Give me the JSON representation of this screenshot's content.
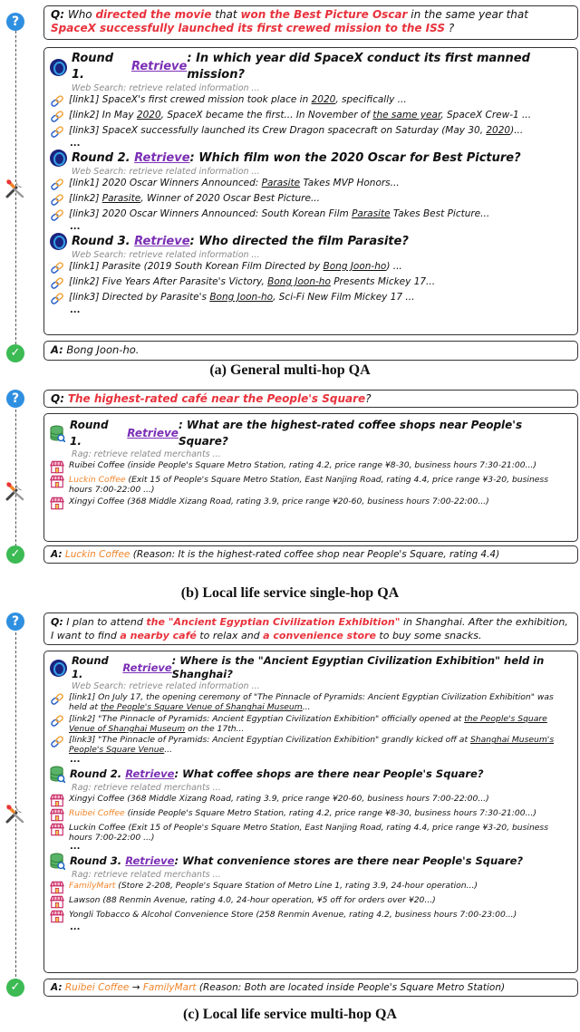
{
  "panels": {
    "a": {
      "caption": "(a) General multi-hop QA",
      "question": {
        "label": "Q:",
        "p1": "Who",
        "h1": "directed the movie",
        "p2": "that",
        "h2": "won the Best Picture Oscar",
        "p3": "in the same year that",
        "h3": "SpaceX successfully launched its first crewed mission to the ISS",
        "p4": "?"
      },
      "rounds": [
        {
          "round": "Round 1.",
          "retrieve": "Retrieve",
          "query": ": In which year did SpaceX conduct its first manned mission?",
          "search": "Web Search: retrieve related information ...",
          "links": [
            {
              "a": "[link1] SpaceX's first crewed mission took place in ",
              "u": "2020",
              "b": ", specifically ..."
            },
            {
              "a": "[link2] In May ",
              "u": "2020",
              "b": ", SpaceX became the first... In November of ",
              "u2": "the same year",
              "c": ", SpaceX Crew-1 ..."
            },
            {
              "a": "[link3] SpaceX successfully launched its Crew Dragon spacecraft on Saturday (May 30, ",
              "u": "2020",
              "b": ")..."
            }
          ],
          "more": "..."
        },
        {
          "round": "Round 2.",
          "retrieve": "Retrieve",
          "query": ": Which film won the 2020 Oscar for Best Picture?",
          "search": "Web Search: retrieve related information ...",
          "links": [
            {
              "a": "[link1] 2020 Oscar Winners Announced: ",
              "u": "Parasite",
              "b": " Takes MVP Honors..."
            },
            {
              "a": "[link2] ",
              "u": "Parasite",
              "b": ", Winner of 2020 Oscar Best Picture..."
            },
            {
              "a": "[link3] 2020 Oscar Winners Announced: South Korean Film ",
              "u": "Parasite",
              "b": " Takes Best Picture..."
            }
          ],
          "more": "..."
        },
        {
          "round": "Round 3.",
          "retrieve": "Retrieve",
          "query": ": Who directed the film Parasite?",
          "search": "Web Search: retrieve related information ...",
          "links": [
            {
              "a": "[link1] Parasite (2019 South Korean Film Directed by ",
              "u": "Bong Joon-ho",
              "b": ") ..."
            },
            {
              "a": "[link2] Five Years After Parasite's Victory, ",
              "u": "Bong Joon-ho",
              "b": " Presents Mickey 17..."
            },
            {
              "a": "[link3] Directed by Parasite's ",
              "u": "Bong Joon-ho",
              "b": ", Sci-Fi New Film Mickey 17 ..."
            }
          ],
          "more": "..."
        }
      ],
      "answer": {
        "label": "A:",
        "text": "Bong Joon-ho."
      }
    },
    "b": {
      "caption": "(b) Local life service single-hop QA",
      "question": {
        "label": "Q:",
        "h1": "The highest-rated café near the People's Square",
        "p1": "?"
      },
      "round": {
        "round": "Round 1.",
        "retrieve": "Retrieve",
        "query": ": What are the highest-rated coffee shops near People's Square?",
        "search": "Rag: retrieve related merchants ...",
        "items": [
          {
            "name": "Ruibei Coffee",
            "detail": " (inside People's Square Metro Station, rating 4.2, price range ¥8-30, business hours 7:30-21:00...)",
            "hl": false
          },
          {
            "name": "Luckin Coffee",
            "detail": " (Exit 15 of People's Square Metro Station, East Nanjing Road, rating 4.4, price range ¥3-20, business hours 7:00-22:00 ...)",
            "hl": true
          },
          {
            "name": "Xingyi Coffee",
            "detail": " (368 Middle Xizang Road, rating 3.9, price range ¥20-60, business hours 7:00-22:00...)",
            "hl": false
          }
        ]
      },
      "answer": {
        "label": "A:",
        "name": "Luckin Coffee",
        "text": " (Reason: It is the highest-rated coffee shop near People's Square, rating 4.4)"
      }
    },
    "c": {
      "caption": "(c) Local life service multi-hop QA",
      "question": {
        "label": "Q:",
        "p1": "I plan to attend",
        "h1": "the \"Ancient Egyptian Civilization Exhibition\"",
        "p2": "in Shanghai. After the exhibition, I want to find",
        "h2": "a nearby café",
        "p3": "to relax and",
        "h3": "a convenience store",
        "p4": "to buy some snacks."
      },
      "round1": {
        "round": "Round 1.",
        "retrieve": "Retrieve",
        "query": ": Where is the \"Ancient Egyptian Civilization Exhibition\" held in Shanghai?",
        "search": "Web Search: retrieve related information ...",
        "links": [
          {
            "a": "[link1] On July 17, the opening ceremony of \"The Pinnacle of Pyramids: Ancient Egyptian Civilization Exhibition\" was held at ",
            "u": "the People's Square Venue of Shanghai Museum",
            "b": "..."
          },
          {
            "a": "[link2] \"The Pinnacle of Pyramids: Ancient Egyptian Civilization Exhibition\" officially opened at ",
            "u": "the People's Square Venue of Shanghai Museum",
            "b": " on the 17th..."
          },
          {
            "a": "[link3] \"The Pinnacle of Pyramids: Ancient Egyptian Civilization Exhibition\" grandly kicked off at ",
            "u": "Shanghai Museum's People's Square Venue",
            "b": "..."
          }
        ],
        "more": "..."
      },
      "round2": {
        "round": "Round 2.",
        "retrieve": "Retrieve",
        "query": ": What coffee shops are there near People's Square?",
        "search": "Rag: retrieve related merchants ...",
        "items": [
          {
            "name": "Xingyi Coffee",
            "detail": " (368 Middle Xizang Road, rating 3.9, price range ¥20-60, business hours 7:00-22:00...)",
            "hl": false
          },
          {
            "name": "Ruibei Coffee",
            "detail": " (inside People's Square Metro Station, rating 4.2, price range ¥8-30, business hours 7:30-21:00...)",
            "hl": true
          },
          {
            "name": "Luckin Coffee",
            "detail": " (Exit 15 of People's Square Metro Station, East Nanjing Road, rating 4.4, price range ¥3-20, business hours 7:00-22:00 ...)",
            "hl": false
          }
        ],
        "more": "..."
      },
      "round3": {
        "round": "Round 3.",
        "retrieve": "Retrieve",
        "query": ": What convenience stores are there near People's Square?",
        "search": "Rag: retrieve related merchants ...",
        "items": [
          {
            "name": "FamilyMart",
            "detail": " (Store 2-208, People's Square Station of Metro Line 1, rating 3.9, 24-hour operation...)",
            "hl": true
          },
          {
            "name": "Lawson",
            "detail": " (88 Renmin Avenue, rating 4.0, 24-hour operation, ¥5 off for orders over ¥20...)",
            "hl": false
          },
          {
            "name": "Yongli Tobacco & Alcohol Convenience Store",
            "detail": " (258 Renmin Avenue, rating 4.2, business hours 7:00-23:00...)",
            "hl": false
          }
        ],
        "more": "..."
      },
      "answer": {
        "label": "A:",
        "name1": "Ruibei Coffee",
        "arrow": " → ",
        "name2": "FamilyMart",
        "text": " (Reason: Both are located inside People's Square Metro Station)"
      }
    }
  },
  "icons": {
    "question": "?",
    "answer": "✓"
  },
  "colors": {
    "highlight_red": "#e8323c",
    "highlight_orange": "#f0852a",
    "retrieve_purple": "#7b2fb5",
    "question_blue": "#2f8fe0",
    "answer_green": "#3cba54"
  }
}
